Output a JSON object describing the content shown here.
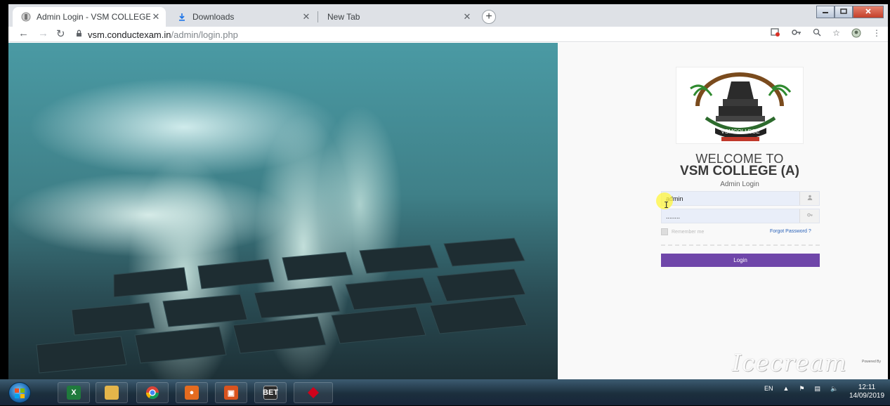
{
  "browser": {
    "tabs": [
      {
        "title": "Admin Login - VSM COLLEGE (A)",
        "icon": "college-logo-icon",
        "active": true
      },
      {
        "title": "Downloads",
        "icon": "download-icon",
        "active": false
      },
      {
        "title": "New Tab",
        "icon": "",
        "active": false
      }
    ],
    "close_glyph": "✕",
    "new_tab_glyph": "+",
    "url_host": "vsm.conductexam.in",
    "url_path": "/admin/login.php"
  },
  "login": {
    "welcome": "WELCOME TO",
    "college_name": "VSM COLLEGE (A)",
    "subtitle": "Admin Login",
    "username_value": "admin",
    "password_value": "........",
    "remember_label": "Remember me",
    "forgot_label": "Forgot Password ?",
    "login_button": "Login",
    "logo_text_top": "VSMCOLLEGE"
  },
  "footer": {
    "powered_by": "Powered By",
    "watermark": "Icecream"
  },
  "taskbar": {
    "language": "EN",
    "time": "12:11",
    "date": "14/09/2019"
  },
  "colors": {
    "accent": "#6f46a9",
    "link": "#2a62b8",
    "field_bg": "#e9eef9"
  }
}
